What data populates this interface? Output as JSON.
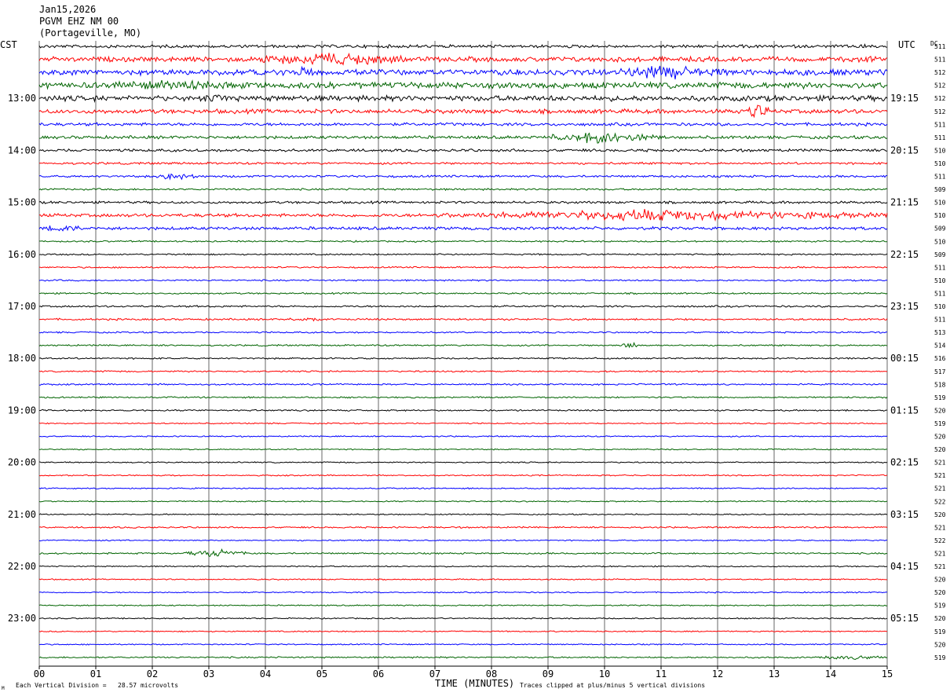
{
  "header": {
    "date": "Jan15,2026",
    "station": "PGVM EHZ NM 00",
    "location": "(Portageville, MO)",
    "left_tz": "CST",
    "right_tz": "UTC",
    "dc_label": "DC"
  },
  "footer": {
    "vertical_division": "Each Vertical Division =   28.57 microvolts",
    "xlabel": "TIME (MINUTES)",
    "clip_note": "Traces clipped at plus/minus 5 vertical divisions",
    "corner_mark": "M"
  },
  "colors": {
    "trace_cycle": [
      "#000000",
      "#ff0000",
      "#0000ff",
      "#006400"
    ],
    "grid": "#000000",
    "background": "#ffffff"
  },
  "chart_data": {
    "type": "helicorder",
    "title": "PGVM EHZ NM 00",
    "xlabel": "TIME (MINUTES)",
    "xlim": [
      0,
      15
    ],
    "x_ticks": [
      "00",
      "01",
      "02",
      "03",
      "04",
      "05",
      "06",
      "07",
      "08",
      "09",
      "10",
      "11",
      "12",
      "13",
      "14",
      "15"
    ],
    "minutes_per_line": 15,
    "line_count": 48,
    "start_time_cst": "12:00",
    "left_hour_labels": [
      {
        "line": 4,
        "label": "13:00"
      },
      {
        "line": 8,
        "label": "14:00"
      },
      {
        "line": 12,
        "label": "15:00"
      },
      {
        "line": 16,
        "label": "16:00"
      },
      {
        "line": 20,
        "label": "17:00"
      },
      {
        "line": 24,
        "label": "18:00"
      },
      {
        "line": 28,
        "label": "19:00"
      },
      {
        "line": 32,
        "label": "20:00"
      },
      {
        "line": 36,
        "label": "21:00"
      },
      {
        "line": 40,
        "label": "22:00"
      },
      {
        "line": 44,
        "label": "23:00"
      }
    ],
    "right_hour_labels": [
      {
        "line": 4,
        "label": "19:15"
      },
      {
        "line": 8,
        "label": "20:15"
      },
      {
        "line": 12,
        "label": "21:15"
      },
      {
        "line": 16,
        "label": "22:15"
      },
      {
        "line": 20,
        "label": "23:15"
      },
      {
        "line": 24,
        "label": "00:15"
      },
      {
        "line": 28,
        "label": "01:15"
      },
      {
        "line": 32,
        "label": "02:15"
      },
      {
        "line": 36,
        "label": "03:15"
      },
      {
        "line": 40,
        "label": "04:15"
      },
      {
        "line": 44,
        "label": "05:15"
      }
    ],
    "dc_offsets": [
      "511",
      "511",
      "512",
      "512",
      "512",
      "512",
      "511",
      "511",
      "510",
      "510",
      "511",
      "509",
      "510",
      "510",
      "509",
      "510",
      "509",
      "511",
      "510",
      "511",
      "510",
      "511",
      "513",
      "514",
      "516",
      "517",
      "518",
      "519",
      "520",
      "519",
      "520",
      "520",
      "521",
      "521",
      "521",
      "522",
      "520",
      "521",
      "522",
      "521",
      "521",
      "520",
      "520",
      "519",
      "520",
      "519",
      "520",
      "519"
    ],
    "amplitude_levels": [
      1.0,
      1.6,
      1.8,
      2.0,
      1.8,
      1.4,
      1.0,
      1.0,
      0.9,
      0.7,
      0.7,
      0.6,
      0.8,
      1.1,
      1.0,
      0.5,
      0.5,
      0.5,
      0.5,
      0.5,
      0.6,
      0.6,
      0.5,
      0.5,
      0.5,
      0.5,
      0.5,
      0.5,
      0.5,
      0.4,
      0.4,
      0.4,
      0.4,
      0.4,
      0.4,
      0.4,
      0.4,
      0.5,
      0.4,
      0.5,
      0.4,
      0.4,
      0.4,
      0.4,
      0.4,
      0.4,
      0.4,
      0.5
    ],
    "events": [
      {
        "line": 0,
        "start_min": 14.3,
        "end_min": 14.8,
        "amp": 1.5
      },
      {
        "line": 1,
        "start_min": 3.8,
        "end_min": 6.5,
        "amp": 4.5
      },
      {
        "line": 1,
        "start_min": 14.2,
        "end_min": 15.0,
        "amp": 2.5
      },
      {
        "line": 2,
        "start_min": 4.3,
        "end_min": 5.0,
        "amp": 3.5
      },
      {
        "line": 2,
        "start_min": 10.1,
        "end_min": 12.3,
        "amp": 4.5
      },
      {
        "line": 2,
        "start_min": 12.5,
        "end_min": 15.0,
        "amp": 2.0
      },
      {
        "line": 3,
        "start_min": 0.5,
        "end_min": 4.0,
        "amp": 3.0
      },
      {
        "line": 4,
        "start_min": 2.5,
        "end_min": 4.0,
        "amp": 2.5
      },
      {
        "line": 5,
        "start_min": 12.4,
        "end_min": 12.9,
        "amp": 5.0
      },
      {
        "line": 7,
        "start_min": 9.0,
        "end_min": 11.0,
        "amp": 4.0
      },
      {
        "line": 10,
        "start_min": 2.0,
        "end_min": 2.8,
        "amp": 2.5
      },
      {
        "line": 13,
        "start_min": 6.8,
        "end_min": 15.0,
        "amp": 3.5
      },
      {
        "line": 14,
        "start_min": 0.0,
        "end_min": 0.9,
        "amp": 2.5
      },
      {
        "line": 21,
        "start_min": 4.4,
        "end_min": 5.1,
        "amp": 2.0
      },
      {
        "line": 23,
        "start_min": 10.3,
        "end_min": 10.6,
        "amp": 2.5
      },
      {
        "line": 39,
        "start_min": 2.6,
        "end_min": 3.7,
        "amp": 2.5
      },
      {
        "line": 47,
        "start_min": 13.8,
        "end_min": 15.0,
        "amp": 1.5
      }
    ],
    "grid": true
  }
}
